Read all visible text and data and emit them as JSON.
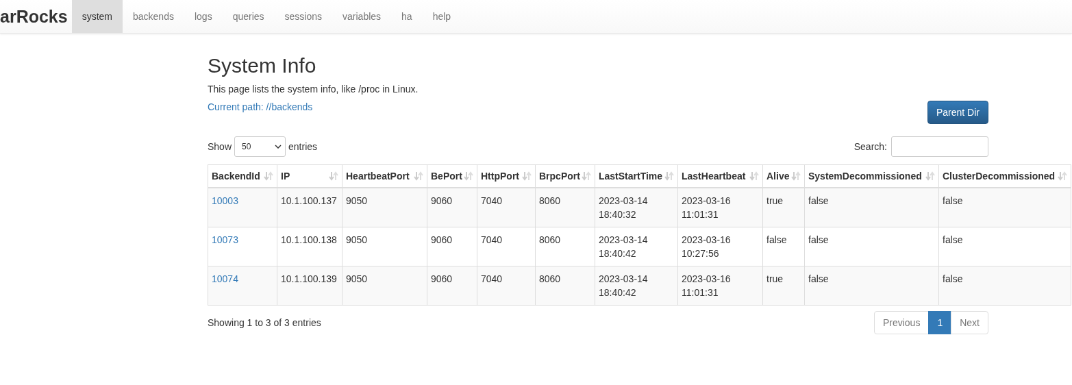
{
  "navbar": {
    "brand": "arRocks",
    "items": [
      {
        "label": "system",
        "selected": true
      },
      {
        "label": "backends",
        "selected": false
      },
      {
        "label": "logs",
        "selected": false
      },
      {
        "label": "queries",
        "selected": false
      },
      {
        "label": "sessions",
        "selected": false
      },
      {
        "label": "variables",
        "selected": false
      },
      {
        "label": "ha",
        "selected": false
      },
      {
        "label": "help",
        "selected": false
      }
    ]
  },
  "title": "System Info",
  "description": "This page lists the system info, like /proc in Linux.",
  "current_path": "Current path: //backends",
  "parent_button": "Parent Dir",
  "length": {
    "label_before": "Show",
    "value": "50",
    "label_after": "entries"
  },
  "search": {
    "label": "Search:"
  },
  "table": {
    "columns": [
      "BackendId",
      "IP",
      "HeartbeatPort",
      "BePort",
      "HttpPort",
      "BrpcPort",
      "LastStartTime",
      "LastHeartbeat",
      "Alive",
      "SystemDecommissioned",
      "ClusterDecommissioned"
    ],
    "rows": [
      [
        "10003",
        "10.1.100.137",
        "9050",
        "9060",
        "7040",
        "8060",
        "2023-03-14 18:40:32",
        "2023-03-16 11:01:31",
        "true",
        "false",
        "false"
      ],
      [
        "10073",
        "10.1.100.138",
        "9050",
        "9060",
        "7040",
        "8060",
        "2023-03-14 18:40:42",
        "2023-03-16 10:27:56",
        "false",
        "false",
        "false"
      ],
      [
        "10074",
        "10.1.100.139",
        "9050",
        "9060",
        "7040",
        "8060",
        "2023-03-14 18:40:42",
        "2023-03-16 11:01:31",
        "true",
        "false",
        "false"
      ]
    ]
  },
  "info": "Showing 1 to 3 of 3 entries",
  "pagination": [
    {
      "label": "Previous",
      "selected": false
    },
    {
      "label": "1",
      "selected": true
    },
    {
      "label": "Next",
      "selected": false
    }
  ]
}
